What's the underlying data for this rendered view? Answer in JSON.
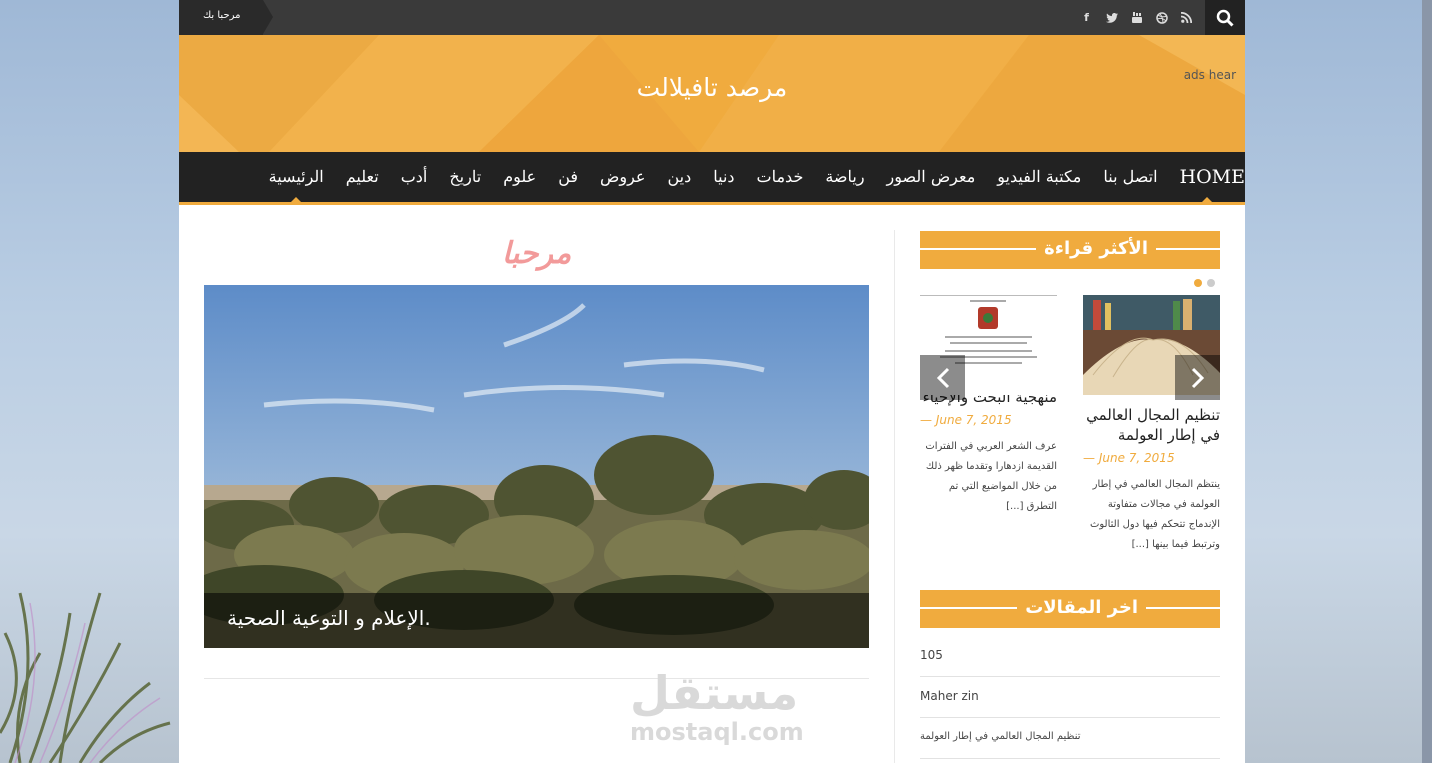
{
  "topbar": {
    "welcome": "مرحبا بك",
    "social_icons": [
      "facebook-icon",
      "twitter-icon",
      "youtube-icon",
      "dribbble-icon",
      "rss-icon"
    ],
    "search_icon": "search-icon"
  },
  "header": {
    "site_title": "مرصد تافيلالت",
    "ads": "ads hear",
    "accent": "#f0ab3e"
  },
  "nav": {
    "items": [
      "HOME",
      "اتصل بنا",
      "مكتبة الفيديو",
      "معرض الصور",
      "رياضة",
      "خدمات",
      "دنيا",
      "دين",
      "عروض",
      "فن",
      "علوم",
      "تاريخ",
      "أدب",
      "تعليم",
      "الرئيسية"
    ]
  },
  "main": {
    "title": "مرحبا",
    "hero_caption": "الإعلام و التوعية الصحية.",
    "watermark": "مستقل",
    "watermark_url": "mostaql.com"
  },
  "sidebar": {
    "most_read_title": "الأكثر قراءة",
    "cards": [
      {
        "title": "تنظيم المجال العالمي في إطار العولمة",
        "date": "June 7, 2015",
        "excerpt": "ينتظم المجال العالمي في إطار العولمة في مجالات متفاوتة الإندماج تتحكم فيها دول الثالوث وترتبط فيما بينها [...]"
      },
      {
        "title": "منهجية البحث والإحياء",
        "date": "June 7, 2015",
        "excerpt": "عرف الشعر العربي في الفترات القديمة ازدهارا وتقدما ظهر ذلك من خلال المواضيع التي تم التطرق [...]"
      }
    ],
    "latest_title": "اخر المقالات",
    "latest": [
      "105",
      "Maher zin",
      "تنظيم المجال العالمي في إطار العولمة"
    ]
  }
}
